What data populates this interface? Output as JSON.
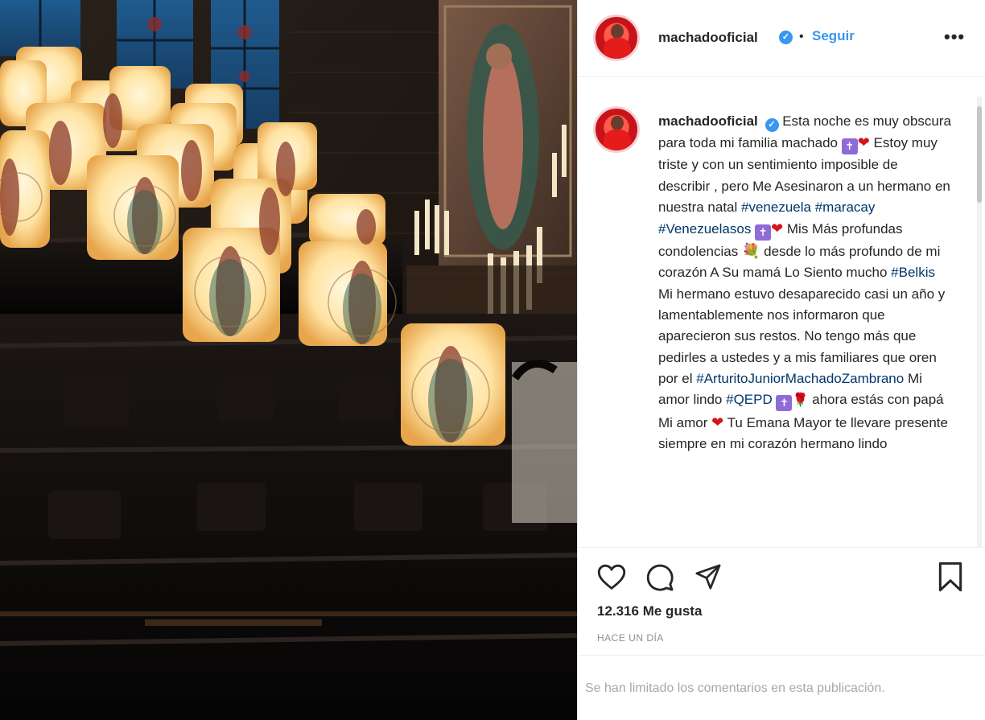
{
  "post": {
    "username": "machadooficial",
    "follow_label": "Seguir",
    "separator": "•",
    "more_label": "•••",
    "verified_symbol": "✓",
    "caption_segments": [
      {
        "type": "text",
        "value": " Esta noche es muy obscura para toda mi familia machado "
      },
      {
        "type": "emoji",
        "value": "✝"
      },
      {
        "type": "heart",
        "value": "❤"
      },
      {
        "type": "text",
        "value": " Estoy muy triste y con un sentimiento imposible de describir , pero Me Asesinaron a un hermano en nuestra natal "
      },
      {
        "type": "tag",
        "value": "#venezuela"
      },
      {
        "type": "text",
        "value": " "
      },
      {
        "type": "tag",
        "value": "#maracay"
      },
      {
        "type": "text",
        "value": " "
      },
      {
        "type": "tag",
        "value": "#Venezuelasos"
      },
      {
        "type": "text",
        "value": " "
      },
      {
        "type": "emoji",
        "value": "✝"
      },
      {
        "type": "heart",
        "value": "❤"
      },
      {
        "type": "text",
        "value": " Mis Más profundas condolencias "
      },
      {
        "type": "bouquet",
        "value": "💐"
      },
      {
        "type": "text",
        "value": " desde lo más profundo de mi corazón A Su mamá Lo Siento mucho "
      },
      {
        "type": "tag",
        "value": "#Belkis"
      },
      {
        "type": "text",
        "value": " Mi hermano estuvo desaparecido casi un año y lamentablemente nos informaron que aparecieron sus restos. No tengo más que pedirles a ustedes y a mis familiares que oren por el "
      },
      {
        "type": "tag",
        "value": "#ArturitoJuniorMachadoZambrano"
      },
      {
        "type": "text",
        "value": " Mi amor lindo "
      },
      {
        "type": "tag",
        "value": "#QEPD"
      },
      {
        "type": "text",
        "value": " "
      },
      {
        "type": "emoji",
        "value": "✝"
      },
      {
        "type": "rose",
        "value": "🌹"
      },
      {
        "type": "text",
        "value": " ahora estás con papá Mi amor "
      },
      {
        "type": "heart",
        "value": "❤"
      },
      {
        "type": "text",
        "value": " Tu Emana Mayor te llevare presente siempre en mi corazón hermano lindo"
      }
    ],
    "likes": "12.316 Me gusta",
    "time_ago": "HACE UN DÍA",
    "comments_limited": "Se han limitado los comentarios en esta publicación.",
    "icons": {
      "like": "heart-outline-icon",
      "comment": "comment-bubble-icon",
      "share": "paper-plane-icon",
      "save": "bookmark-icon"
    },
    "colors": {
      "link": "#3897f0",
      "hashtag": "#00376b",
      "muted": "#8e8e8e",
      "heart": "#d6141e"
    }
  }
}
